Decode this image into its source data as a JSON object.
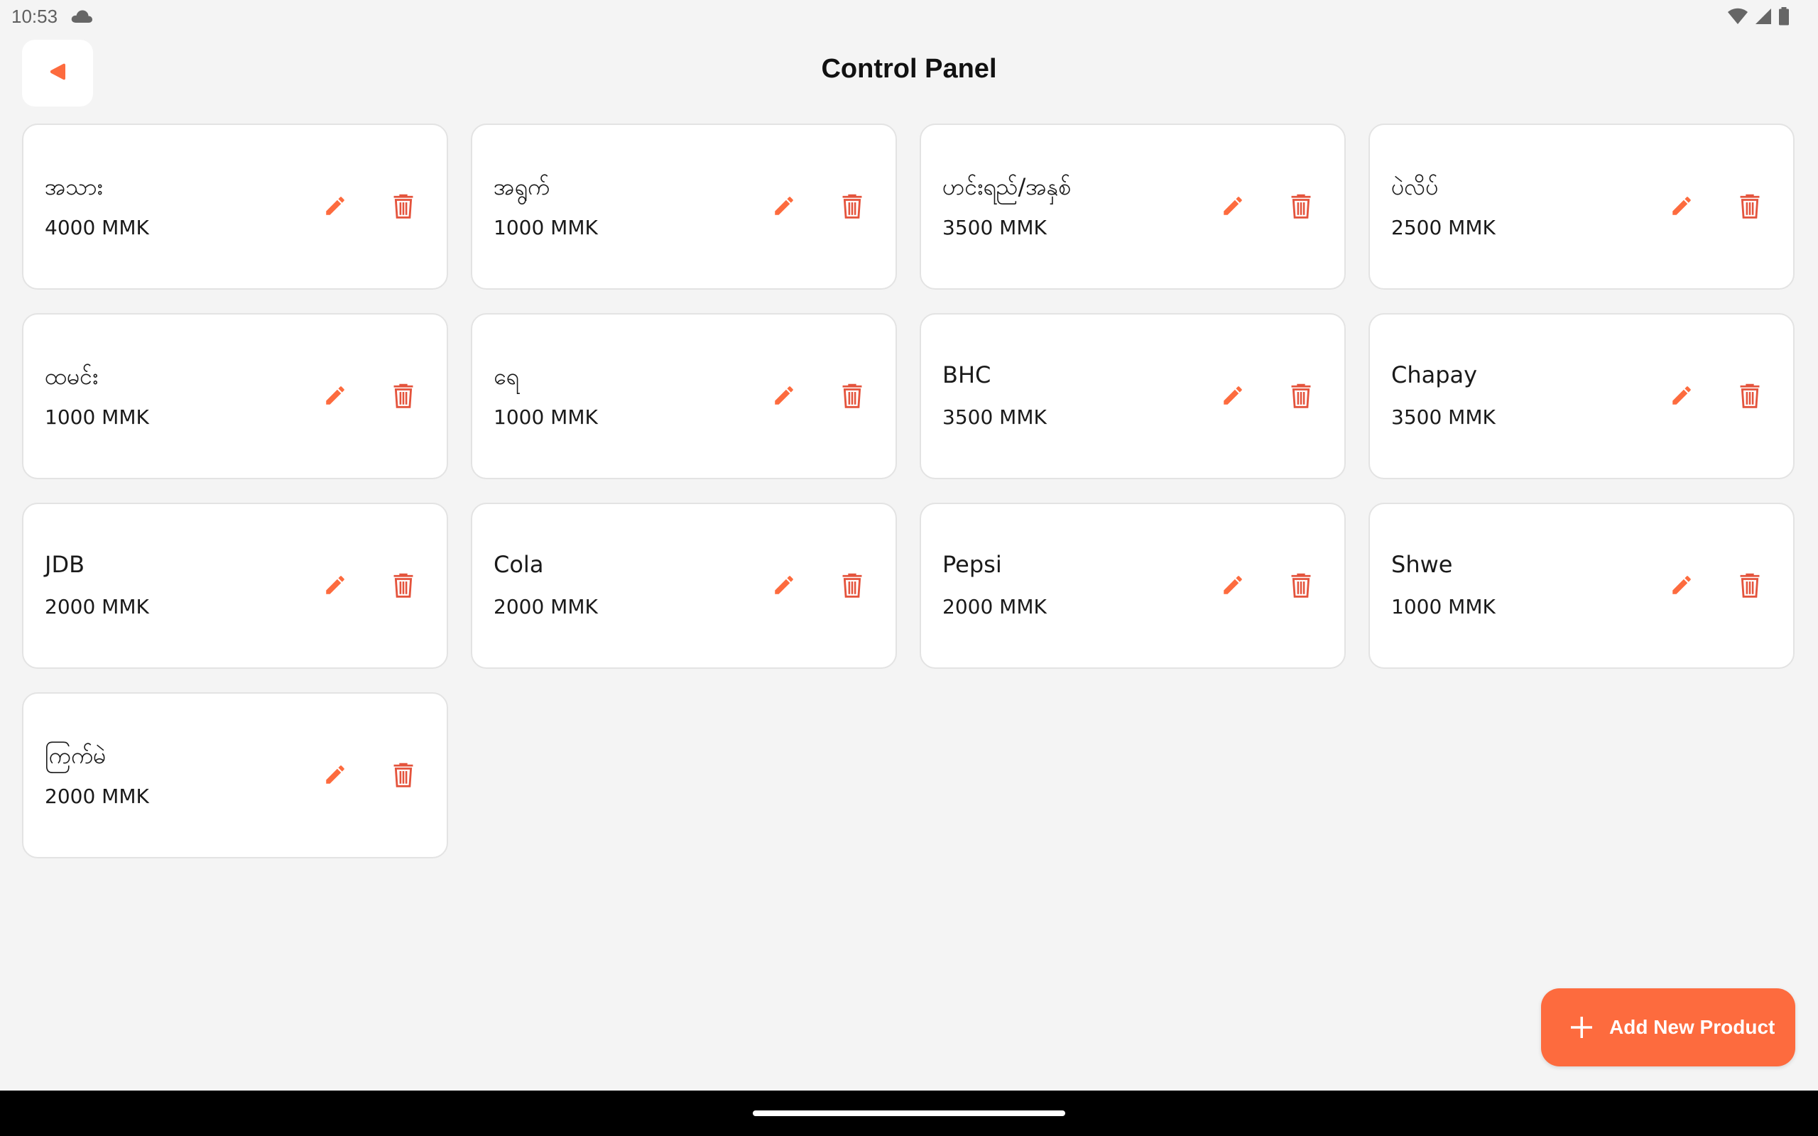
{
  "status_bar": {
    "time": "10:53",
    "icons": [
      "cloud-icon",
      "wifi-icon",
      "signal-icon",
      "battery-icon"
    ]
  },
  "header": {
    "title": "Control Panel",
    "back_icon": "back-triangle-icon"
  },
  "colors": {
    "accent": "#fd6b3e",
    "delete": "#e4533c",
    "background": "#f4f4f4",
    "card": "#ffffff"
  },
  "products": [
    {
      "name": "အသား",
      "price": "4000 MMK"
    },
    {
      "name": "အရွက်",
      "price": "1000 MMK"
    },
    {
      "name": "ဟင်းရည်/အနှစ်",
      "price": "3500 MMK"
    },
    {
      "name": "ပဲလိပ်",
      "price": "2500 MMK"
    },
    {
      "name": "ထမင်း",
      "price": "1000 MMK"
    },
    {
      "name": "ရေ",
      "price": "1000 MMK"
    },
    {
      "name": "BHC",
      "price": "3500 MMK"
    },
    {
      "name": "Chapay",
      "price": "3500 MMK"
    },
    {
      "name": "JDB",
      "price": "2000 MMK"
    },
    {
      "name": "Cola",
      "price": "2000 MMK"
    },
    {
      "name": "Pepsi",
      "price": "2000 MMK"
    },
    {
      "name": "Shwe",
      "price": "1000 MMK"
    },
    {
      "name": "ကြက်မဲ",
      "price": "2000 MMK"
    }
  ],
  "fab": {
    "label": "Add New Product",
    "icon": "plus-icon"
  }
}
